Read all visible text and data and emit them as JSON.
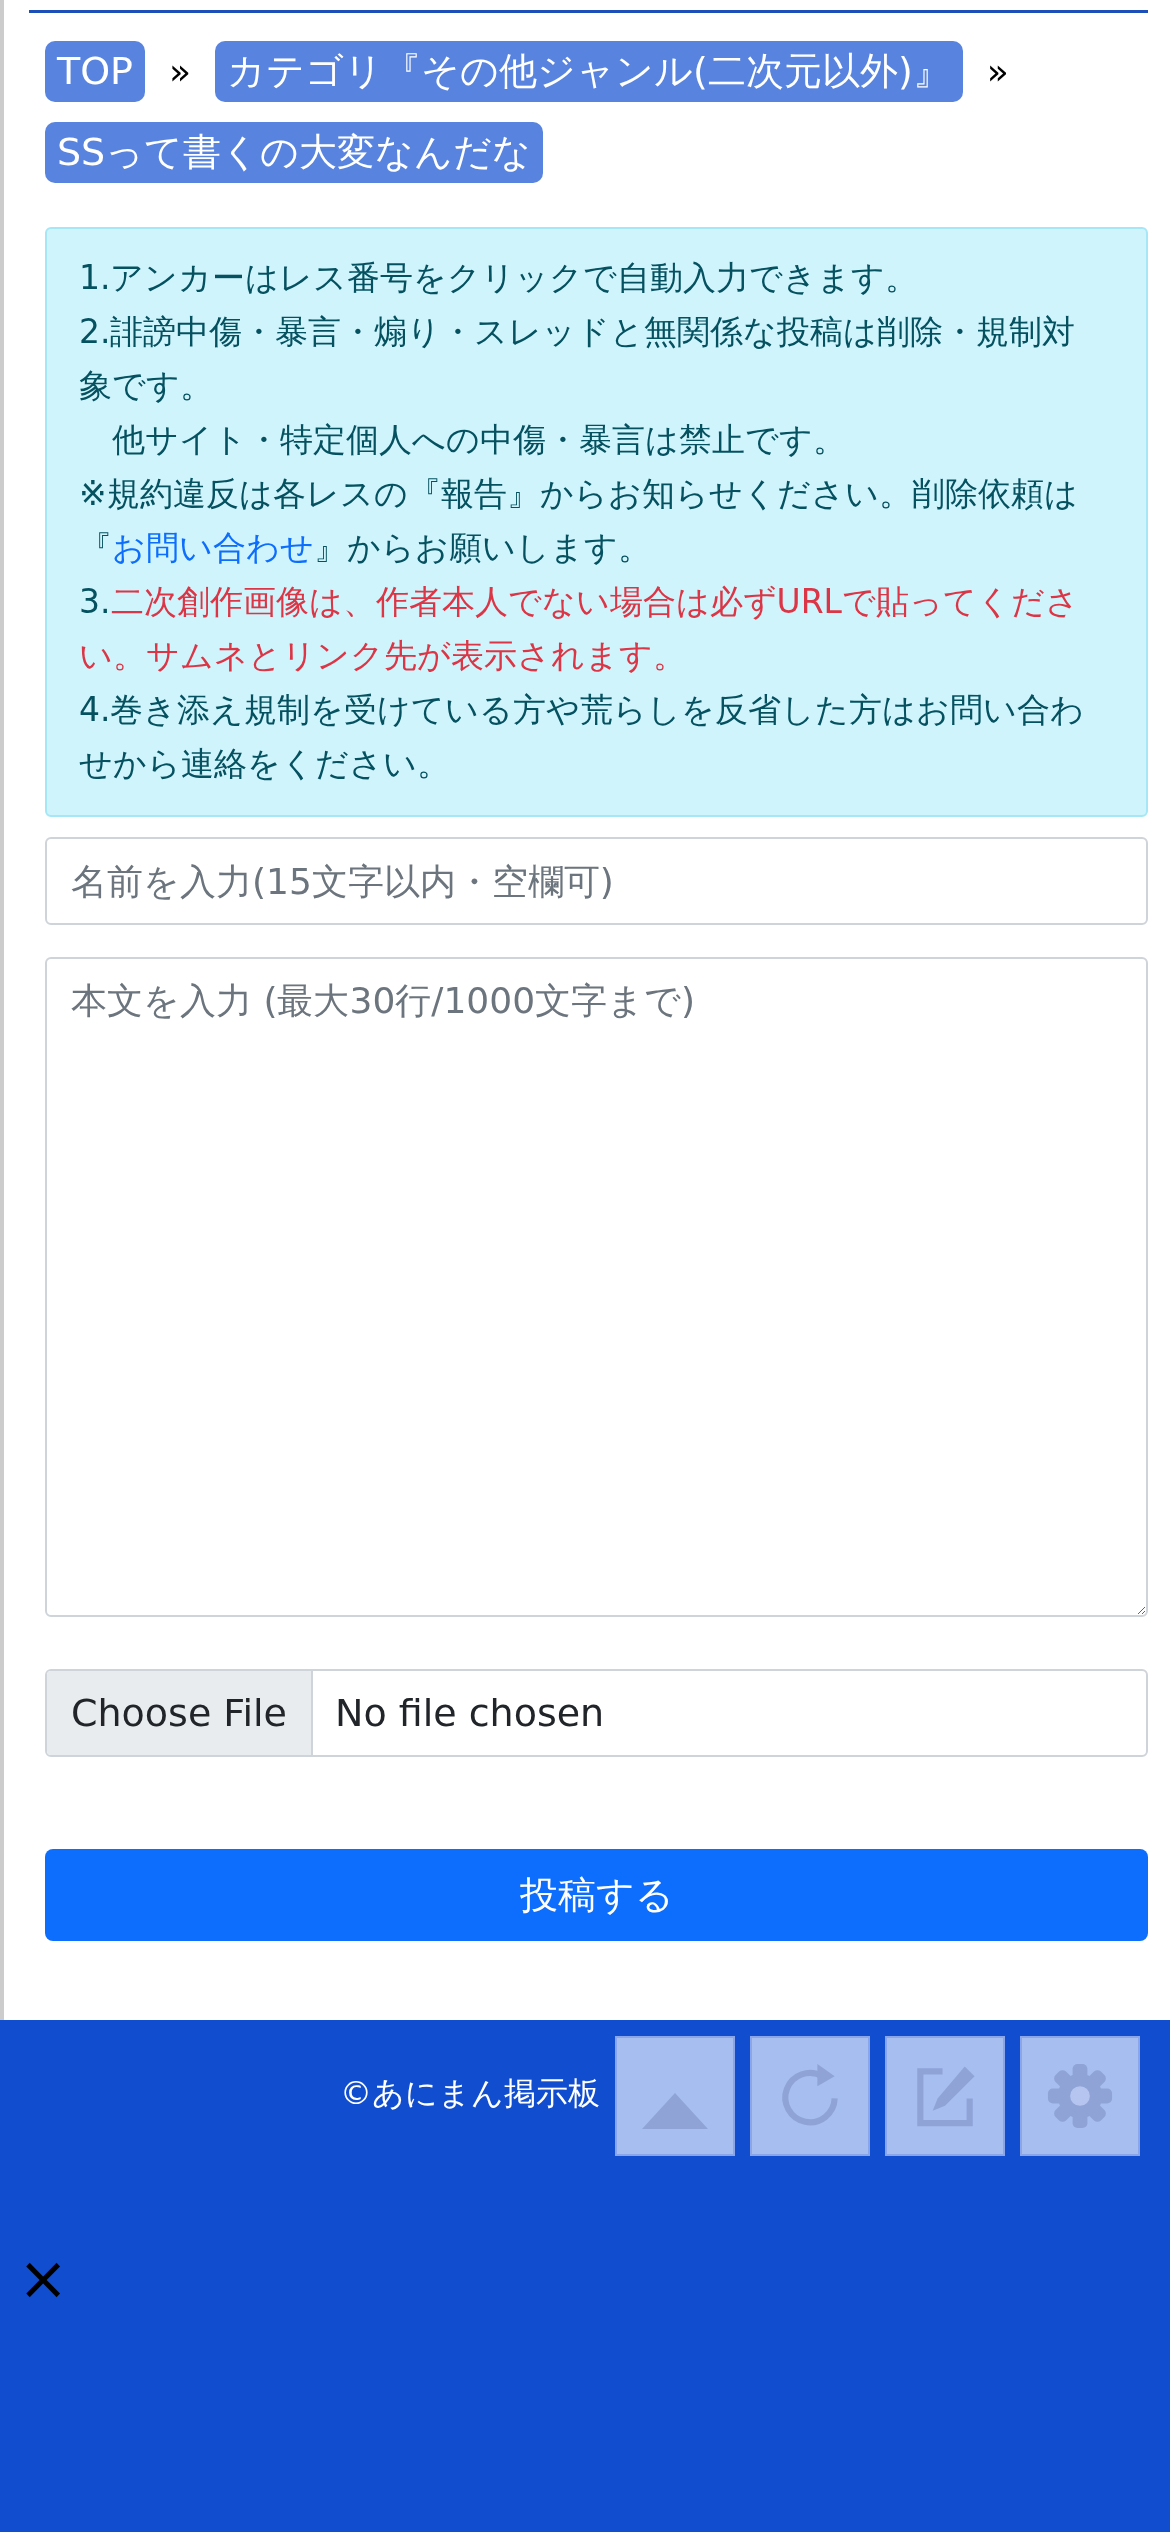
{
  "breadcrumbs": [
    {
      "label": "TOP",
      "separator": "»"
    },
    {
      "label": "カテゴリ『その他ジャンル(二次元以外)』",
      "separator": "»"
    },
    {
      "label": "SSって書くの大変なんだな"
    }
  ],
  "notice": [
    [
      {
        "kind": "text",
        "text": "1.アンカーはレス番号をクリックで自動入力できます。"
      }
    ],
    [
      {
        "kind": "text",
        "text": "2.誹謗中傷・暴言・煽り・スレッドと無関係な投稿は削除・規制対象です。"
      }
    ],
    [
      {
        "kind": "text",
        "text": "　他サイト・特定個人への中傷・暴言は禁止です。"
      }
    ],
    [
      {
        "kind": "text",
        "text": "※規約違反は各レスの『報告』からお知らせください。削除依頼は『"
      },
      {
        "kind": "link",
        "text": "お問い合わせ"
      },
      {
        "kind": "text",
        "text": "』からお願いします。"
      }
    ],
    [
      {
        "kind": "text",
        "text": "3."
      },
      {
        "kind": "alert",
        "text": "二次創作画像は、作者本人でない場合は必ずURLで貼ってください。サムネとリンク先が表示されます。"
      }
    ],
    [
      {
        "kind": "text",
        "text": "4.巻き添え規制を受けている方や荒らしを反省した方はお問い合わせから連絡をください。"
      }
    ]
  ],
  "name_field": {
    "placeholder": "名前を入力(15文字以内・空欄可)"
  },
  "body_field": {
    "placeholder": "本文を入力 (最大30行/1000文字まで)"
  },
  "file_input": {
    "button": "Choose File",
    "status": "No file chosen"
  },
  "submit": "投稿する",
  "footer": {
    "copyright": "©あにまん掲示板",
    "close": "×"
  },
  "floating_buttons": [
    {
      "kind": "top"
    },
    {
      "kind": "reload"
    },
    {
      "kind": "write"
    },
    {
      "kind": "settings"
    }
  ]
}
